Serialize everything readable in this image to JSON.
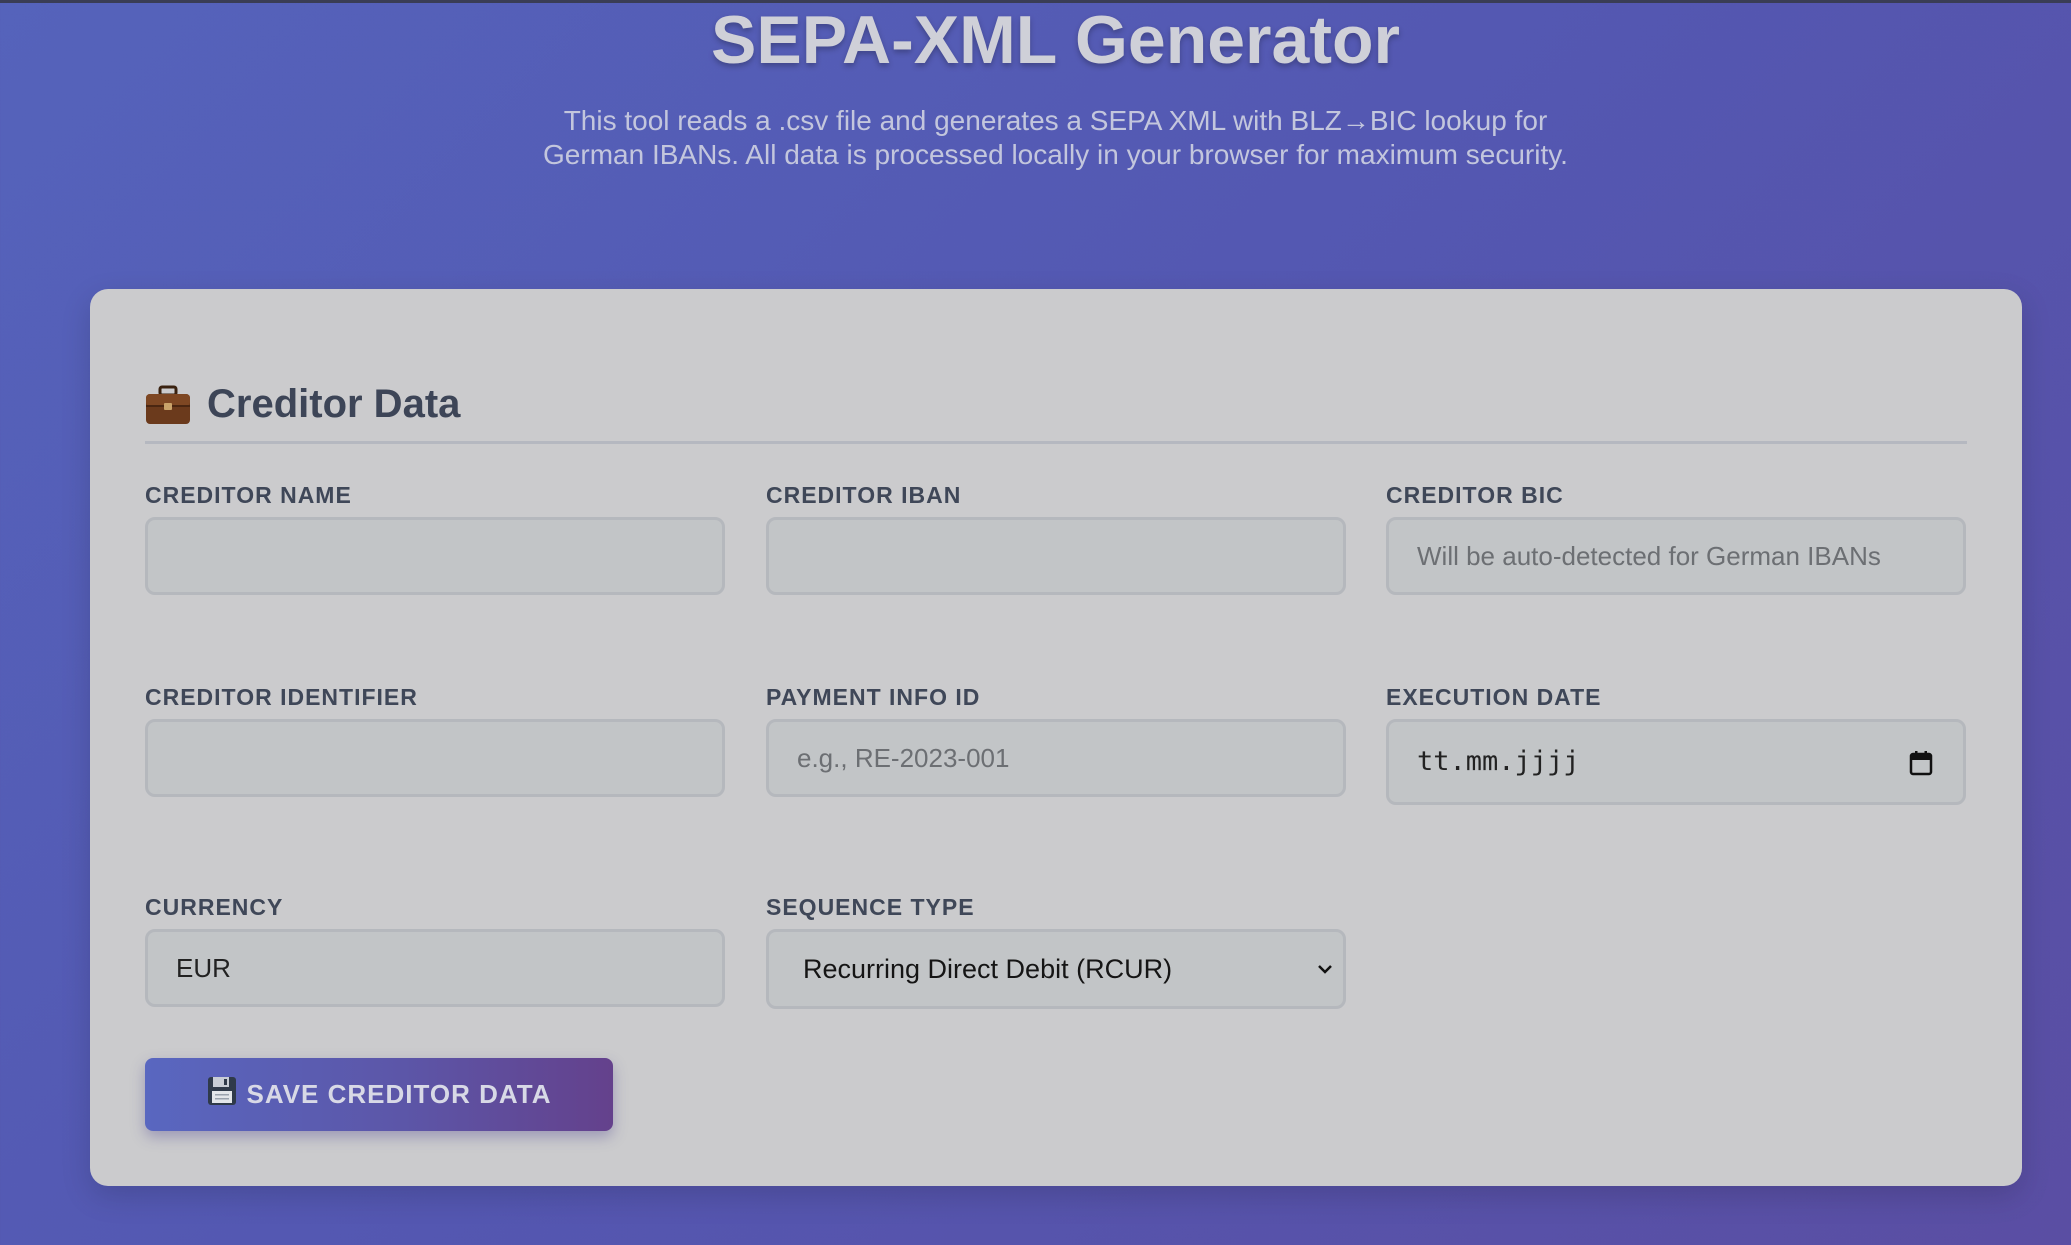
{
  "header": {
    "title": "SEPA-XML Generator",
    "subtitle": "This tool reads a .csv file and generates a SEPA XML with BLZ→BIC lookup for German IBANs. All data is processed locally in your browser for maximum security."
  },
  "section": {
    "icon": "briefcase-icon",
    "title": "Creditor Data"
  },
  "fields": {
    "creditor_name": {
      "label": "CREDITOR NAME",
      "value": "",
      "placeholder": ""
    },
    "creditor_iban": {
      "label": "CREDITOR IBAN",
      "value": "",
      "placeholder": ""
    },
    "creditor_bic": {
      "label": "CREDITOR BIC",
      "value": "",
      "placeholder": "Will be auto-detected for German IBANs"
    },
    "creditor_identifier": {
      "label": "CREDITOR IDENTIFIER",
      "value": "",
      "placeholder": ""
    },
    "payment_info_id": {
      "label": "PAYMENT INFO ID",
      "value": "",
      "placeholder": "e.g., RE-2023-001"
    },
    "execution_date": {
      "label": "EXECUTION DATE",
      "display": "tt.mm.jjjj",
      "icon": "calendar-icon"
    },
    "currency": {
      "label": "CURRENCY",
      "value": "EUR"
    },
    "sequence_type": {
      "label": "SEQUENCE TYPE",
      "selected": "Recurring Direct Debit (RCUR)",
      "icon": "chevron-down-icon"
    }
  },
  "save_button": {
    "icon": "floppy-disk-icon",
    "label": "SAVE CREDITOR DATA"
  },
  "colors": {
    "background_start": "#5563bb",
    "background_end": "#5a4ea3",
    "card": "#cbcbcd",
    "input_bg": "#c2c5c7",
    "label": "#3f4758",
    "button_start": "#5967c0",
    "button_end": "#64418c"
  }
}
